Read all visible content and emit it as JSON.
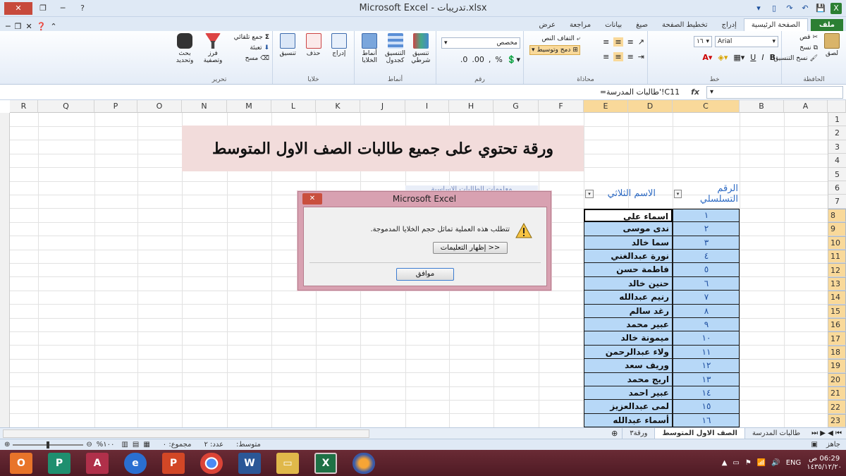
{
  "window": {
    "title": "Microsoft Excel - تدريبات.xlsx"
  },
  "tabs": [
    {
      "label": "ملف"
    },
    {
      "label": "الصفحة الرئيسية"
    },
    {
      "label": "إدراج"
    },
    {
      "label": "تخطيط الصفحة"
    },
    {
      "label": "صيغ"
    },
    {
      "label": "بيانات"
    },
    {
      "label": "مراجعة"
    },
    {
      "label": "عرض"
    }
  ],
  "ribbon": {
    "clipboard": {
      "group": "الحافظة",
      "paste": "لصق",
      "cut": "قص",
      "copy": "نسخ",
      "format_painter": "نسخ التنسيق"
    },
    "font": {
      "group": "خط",
      "name": "Arial",
      "size": "١٦"
    },
    "alignment": {
      "group": "محاذاة",
      "wrap": "التفاف النص",
      "merge": "دمج وتوسيط"
    },
    "number": {
      "group": "رقم",
      "format": "مخصص"
    },
    "styles": {
      "group": "أنماط",
      "conditional": "تنسيق شرطي",
      "as_table": "التنسيق كجدول",
      "cell_styles": "أنماط الخلايا"
    },
    "cells": {
      "group": "خلايا",
      "insert": "إدراج",
      "delete": "حذف",
      "format": "تنسيق"
    },
    "editing": {
      "group": "تحرير",
      "autosum": "جمع تلقائي",
      "fill": "تعبئة",
      "clear": "مسح",
      "sort": "فرز وتصفية",
      "find": "بحث وتحديد"
    }
  },
  "formula_bar": {
    "name_box": "",
    "formula": "=طالبات المدرسة'!C11"
  },
  "columns": [
    "R",
    "Q",
    "P",
    "O",
    "N",
    "M",
    "L",
    "K",
    "J",
    "I",
    "H",
    "G",
    "F",
    "E",
    "D",
    "C",
    "B",
    "A"
  ],
  "rows": [
    "1",
    "2",
    "3",
    "4",
    "5",
    "6",
    "7",
    "8",
    "9",
    "10",
    "11",
    "12",
    "13",
    "14",
    "15",
    "16",
    "17",
    "18",
    "19",
    "20",
    "21",
    "22",
    "23"
  ],
  "banner": "ورقة تحتوي على جميع طالبات الصف الاول المتوسط",
  "headers": {
    "serial": "الرقم التسلسلي",
    "name": "الاسم الثلاثي",
    "hidden": "معلومات الطالبات الاساسية"
  },
  "students": [
    {
      "num": "١",
      "name": "اسماء علي"
    },
    {
      "num": "٢",
      "name": "ندى موسى"
    },
    {
      "num": "٣",
      "name": "سما خالد"
    },
    {
      "num": "٤",
      "name": "نورة عبدالغني"
    },
    {
      "num": "٥",
      "name": "فاطمة حسن"
    },
    {
      "num": "٦",
      "name": "حنين خالد"
    },
    {
      "num": "٧",
      "name": "رنيم عبدالله"
    },
    {
      "num": "٨",
      "name": "رغد سالم"
    },
    {
      "num": "٩",
      "name": "عبير محمد"
    },
    {
      "num": "١٠",
      "name": "ميمونة خالد"
    },
    {
      "num": "١١",
      "name": "ولاء عبدالرحمن"
    },
    {
      "num": "١٢",
      "name": "وريف سعد"
    },
    {
      "num": "١٣",
      "name": "اريج محمد"
    },
    {
      "num": "١٤",
      "name": "عبير احمد"
    },
    {
      "num": "١٥",
      "name": "لمى عبدالعزيز"
    },
    {
      "num": "١٦",
      "name": "أسماء عبدالله"
    }
  ],
  "dialog": {
    "title": "Microsoft Excel",
    "message": "تتطلب هذه العملية تماثل حجم الخلايا المدموجة.",
    "show_help": "إظهار التعليمات >>",
    "ok": "موافق",
    "close": "✕"
  },
  "sheets": [
    {
      "label": "طالبات المدرسة"
    },
    {
      "label": "الصف الاول المتوسط"
    },
    {
      "label": "ورقة٣"
    }
  ],
  "status": {
    "ready": "جاهز",
    "average": "متوسط:",
    "count": "عدد: ٢",
    "sum": "مجموع: ٠",
    "zoom": "١٠٠%"
  },
  "tray": {
    "lang": "ENG",
    "time": "06:29 ص",
    "date": "١٤٣٥/١٢/٢٠"
  },
  "colors": {
    "accent_green": "#2c7f33",
    "selected_header": "#f9d99a",
    "banner_bg": "#f2dcdb",
    "cell_blue": "#b7d8f7",
    "dialog_frame": "#d8a1b1"
  }
}
